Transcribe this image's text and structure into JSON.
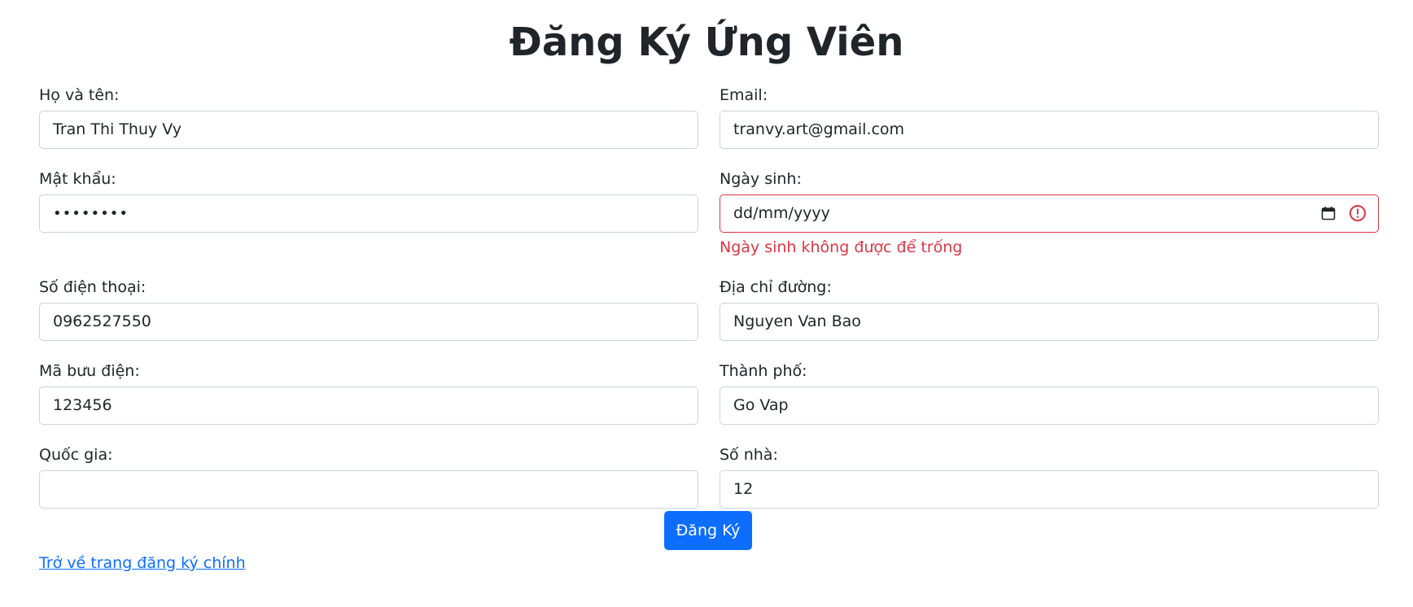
{
  "page": {
    "title": "Đăng Ký Ứng Viên"
  },
  "form": {
    "full_name": {
      "label": "Họ và tên:",
      "value": "Tran Thi Thuy Vy"
    },
    "email": {
      "label": "Email:",
      "value": "tranvy.art@gmail.com"
    },
    "password": {
      "label": "Mật khẩu:",
      "value": "••••••••"
    },
    "birth_date": {
      "label": "Ngày sinh:",
      "value": "dd/mm/yyyy",
      "error": "Ngày sinh không được để trống",
      "error_color": "#dc3545"
    },
    "phone": {
      "label": "Số điện thoại:",
      "value": "0962527550"
    },
    "street": {
      "label": "Địa chỉ đường:",
      "value": "Nguyen Van Bao"
    },
    "postal_code": {
      "label": "Mã bưu điện:",
      "value": "123456"
    },
    "city": {
      "label": "Thành phố:",
      "value": "Go Vap"
    },
    "country": {
      "label": "Quốc gia:",
      "value": ""
    },
    "house_number": {
      "label": "Số nhà:",
      "value": "12"
    }
  },
  "actions": {
    "submit_label": "Đăng Ký",
    "back_link_label": "Trở về trang đăng ký chính"
  },
  "colors": {
    "primary": "#0d6efd",
    "danger": "#dc3545",
    "border": "#ced4da"
  },
  "icons": {
    "calendar": "calendar-icon",
    "warning": "error-circle-icon"
  }
}
